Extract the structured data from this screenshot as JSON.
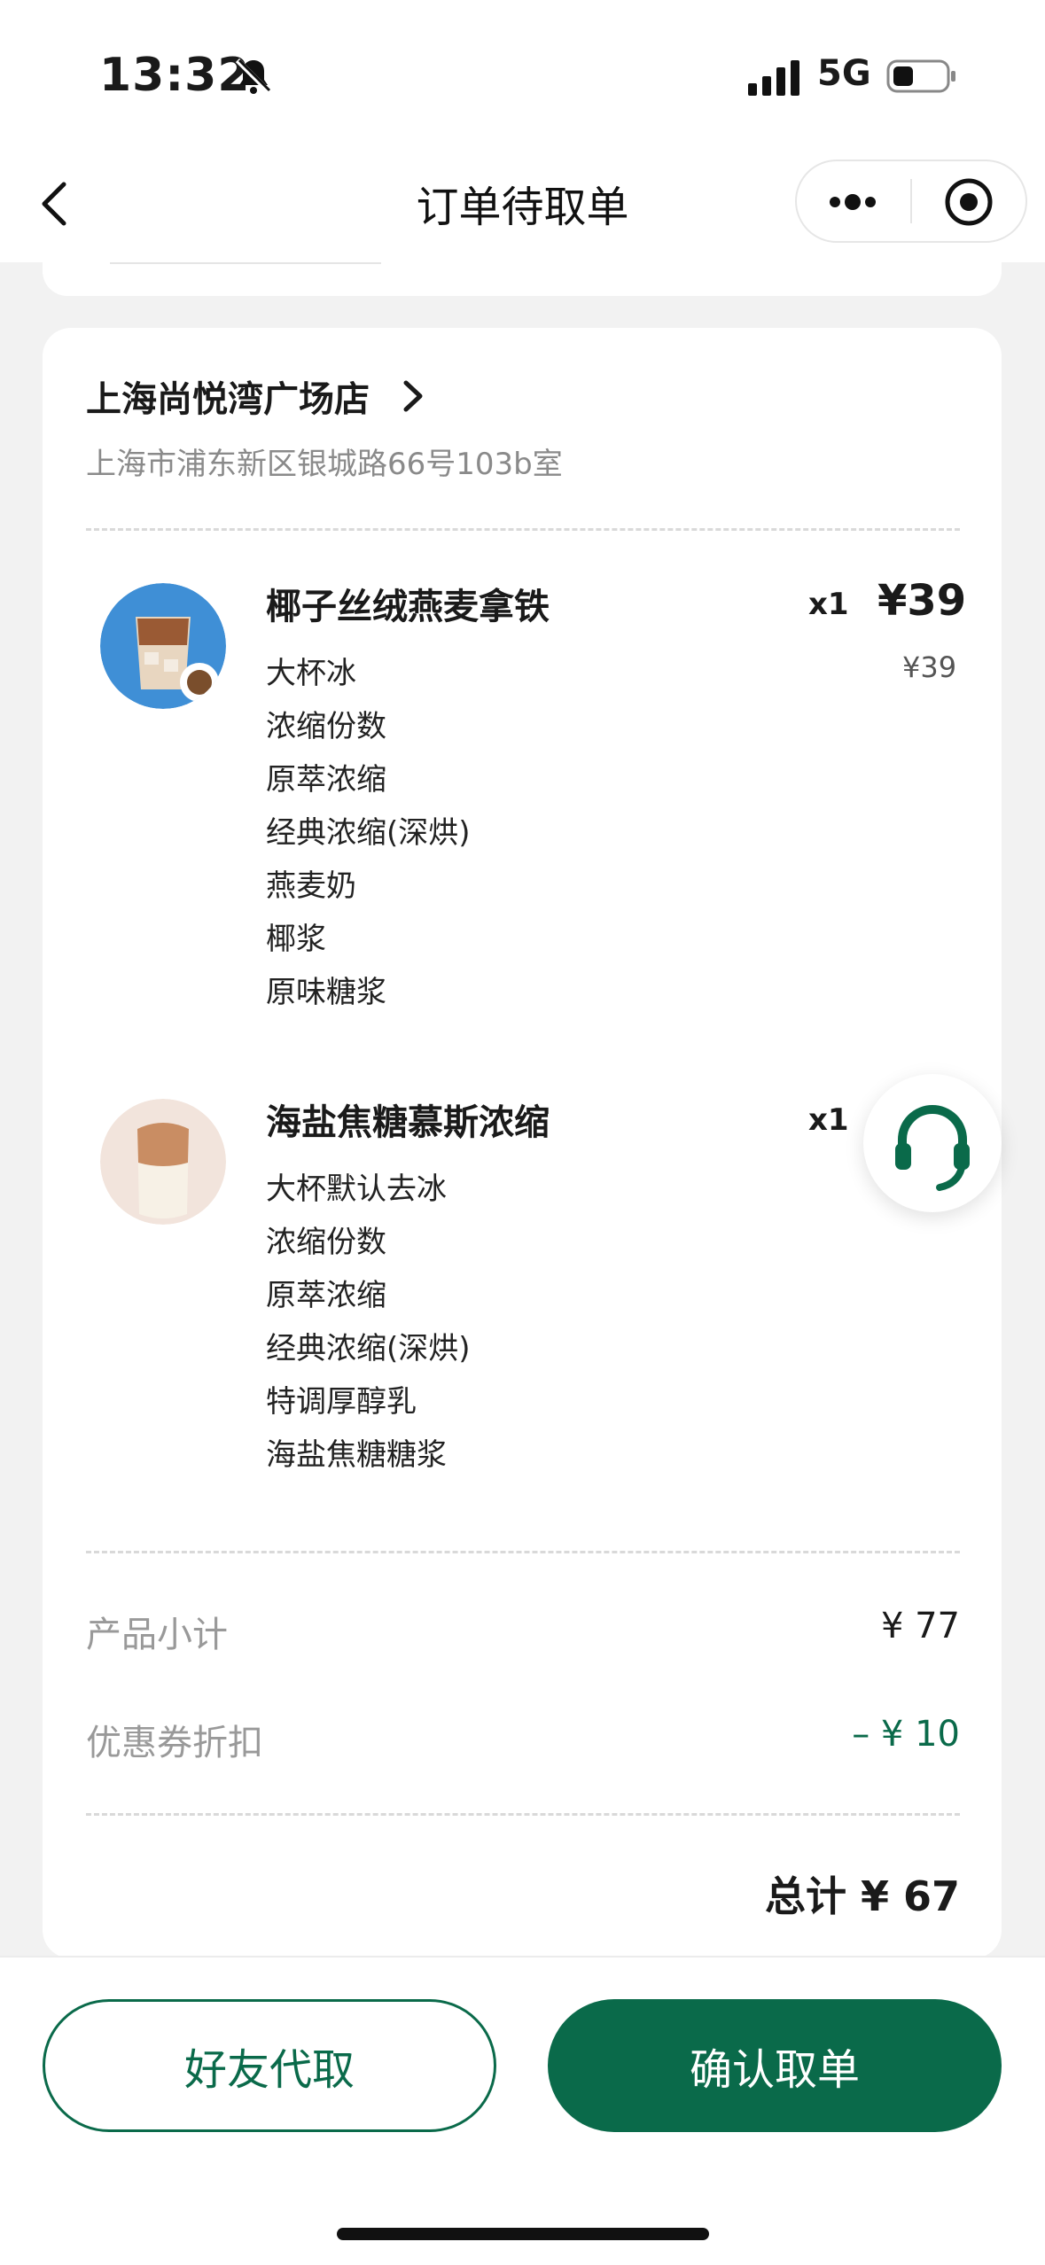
{
  "status": {
    "time": "13:32",
    "network": "5G"
  },
  "nav": {
    "title": "订单待取单"
  },
  "store": {
    "name": "上海尚悦湾广场店",
    "address": "上海市浦东新区银城路66号103b室"
  },
  "products": [
    {
      "name": "椰子丝绒燕麦拿铁",
      "qty": "x1",
      "price": "¥39",
      "unit_price": "¥39",
      "options": [
        "大杯冰",
        "浓缩份数",
        "原萃浓缩",
        "经典浓缩(深烘)",
        "燕麦奶",
        "椰浆",
        "原味糖浆"
      ],
      "image": "coconut-latte-image"
    },
    {
      "name": "海盐焦糖慕斯浓缩",
      "qty": "x1",
      "options": [
        "大杯默认去冰",
        "浓缩份数",
        "原萃浓缩",
        "经典浓缩(深烘)",
        "特调厚醇乳",
        "海盐焦糖糖浆"
      ],
      "image": "caramel-mousse-image"
    }
  ],
  "summary": {
    "subtotal_label": "产品小计",
    "subtotal_value": "¥ 77",
    "coupon_label": "优惠券折扣",
    "coupon_value": "– ¥ 10",
    "total": "总计 ¥ 67"
  },
  "actions": {
    "friend_pickup": "好友代取",
    "confirm_pickup": "确认取单"
  },
  "colors": {
    "brand_green": "#0a6a4a"
  },
  "icons": [
    "bell-off-icon",
    "signal-icon",
    "battery-icon",
    "back-icon",
    "more-icon",
    "target-icon",
    "chevron-right-icon",
    "headset-icon"
  ]
}
